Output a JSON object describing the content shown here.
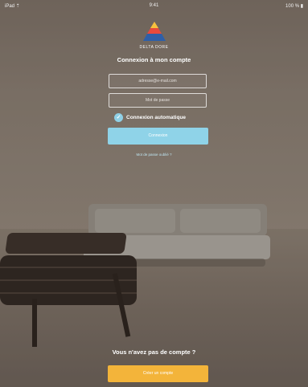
{
  "status_bar": {
    "left": "iPad ⇡",
    "center": "9:41",
    "right": "100 % ▮"
  },
  "brand": {
    "name": "DELTA DORE"
  },
  "login": {
    "title": "Connexion à mon compte",
    "email_value": "adresse@e-mail.com",
    "password_placeholder": "Mot de passe",
    "auto_login_label": "Connexion automatique",
    "auto_login_checked": true,
    "connect_button": "Connexion",
    "forgot_link": "Mot de passe oublié ?"
  },
  "signup": {
    "prompt": "Vous n'avez pas de compte ?",
    "button": "Créer un compte"
  },
  "colors": {
    "accent_blue": "#8fd3e8",
    "accent_orange": "#f3b43a"
  }
}
